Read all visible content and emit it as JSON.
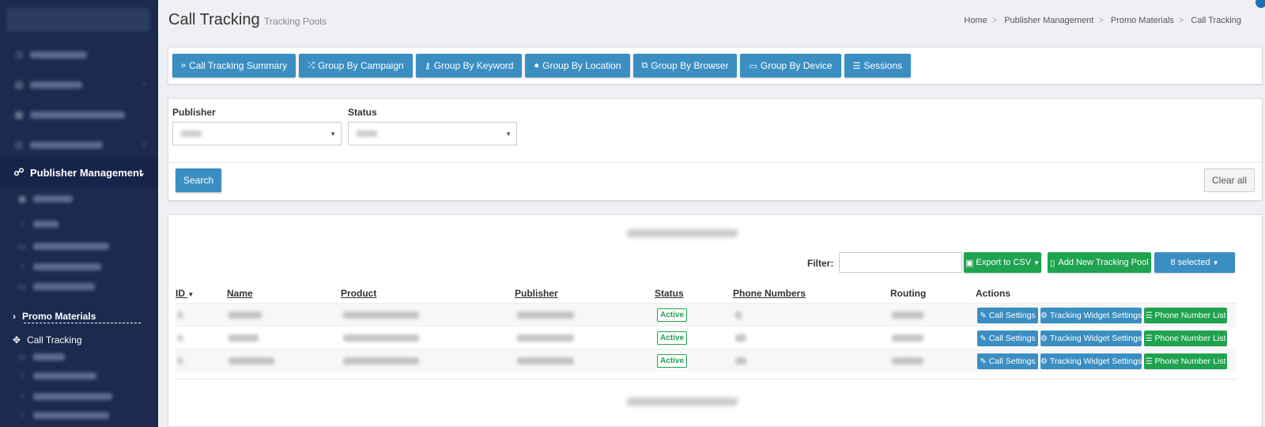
{
  "header": {
    "title": "Call Tracking",
    "subtitle": "Tracking Pools",
    "breadcrumb": [
      "Home",
      "Publisher Management",
      "Promo Materials",
      "Call Tracking"
    ]
  },
  "sidebar": {
    "active_section": "Publisher Management",
    "promo_materials": "Promo Materials",
    "call_tracking": "Call Tracking"
  },
  "tabs": [
    {
      "label": "Call Tracking Summary",
      "icon": "double-chevron-right-icon"
    },
    {
      "label": "Group By Campaign",
      "icon": "shuffle-icon"
    },
    {
      "label": "Group By Keyword",
      "icon": "key-icon"
    },
    {
      "label": "Group By Location",
      "icon": "globe-icon"
    },
    {
      "label": "Group By Browser",
      "icon": "windows-icon"
    },
    {
      "label": "Group By Device",
      "icon": "laptop-icon"
    },
    {
      "label": "Sessions",
      "icon": "list-icon"
    }
  ],
  "filters": {
    "publisher_label": "Publisher",
    "status_label": "Status",
    "search_button": "Search",
    "clear_button": "Clear all"
  },
  "table_toolbar": {
    "filter_label": "Filter:",
    "export_button": "Export to CSV",
    "add_button": "Add New Tracking Pool",
    "columns_button": "8 selected"
  },
  "table": {
    "headers": [
      "ID",
      "Name",
      "Product",
      "Publisher",
      "Status",
      "Phone Numbers",
      "Routing",
      "Actions"
    ],
    "rows": [
      {
        "status": "Active",
        "actions": [
          "Call Settings",
          "Tracking Widget Settings",
          "Phone Number List"
        ]
      },
      {
        "status": "Active",
        "actions": [
          "Call Settings",
          "Tracking Widget Settings",
          "Phone Number List"
        ]
      },
      {
        "status": "Active",
        "actions": [
          "Call Settings",
          "Tracking Widget Settings",
          "Phone Number List"
        ]
      }
    ]
  },
  "colors": {
    "sidebar_bg": "#1b2a4e",
    "primary_blue": "#3b8ec2",
    "success_green": "#1fa34f"
  }
}
